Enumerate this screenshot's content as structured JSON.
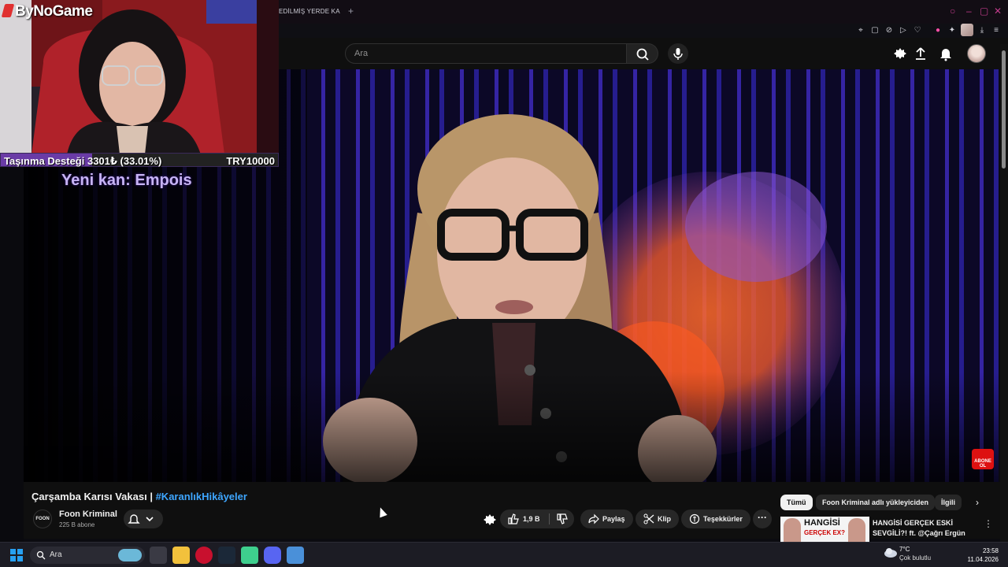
{
  "browser": {
    "tab_title": "EDİLMİŞ YERDE KA",
    "new_tab": "+"
  },
  "youtube": {
    "search": {
      "placeholder": "Ara"
    }
  },
  "stream_overlay": {
    "brand": "ByNoGame",
    "donation": {
      "label": "Taşınma Desteği 3301₺ (33.01%)",
      "goal": "TRY10000",
      "progress": 0.3301
    },
    "new_subscriber": "Yeni kan: Empois"
  },
  "video": {
    "subscribe_badge": "ABONE OL",
    "title_main": "Çarşamba Karısı Vakası | ",
    "title_tag": "#KaranlıkHikâyeler",
    "channel": {
      "logo_text": "FOON",
      "name": "Foon Kriminal",
      "subscribers": "225 B abone"
    },
    "actions": {
      "likes": "1,9 B",
      "share": "Paylaş",
      "clip": "Klip",
      "thanks": "Teşekkürler",
      "more": "···"
    }
  },
  "sidebar": {
    "chips": [
      "Tümü",
      "Foon Kriminal adlı yükleyiciden",
      "İlgili"
    ],
    "recommendation": {
      "thumb_text_1": "HANGİSİ",
      "thumb_text_2": "GERÇEK EX?",
      "title": "HANGİSİ GERÇEK ESKİ SEVGİLİ?! ft. @Çağrı Ergün"
    }
  },
  "taskbar": {
    "search_placeholder": "Ara",
    "weather_temp": "7°C",
    "weather_desc": "Çok bulutlu",
    "time": "23:58",
    "date": "11.04.2026"
  },
  "colors": {
    "accent_pink": "#ff4fa8",
    "link_blue": "#3ea6ff",
    "donation_purple": "#6a3ba6",
    "windows_blue": "#27a0f2"
  }
}
